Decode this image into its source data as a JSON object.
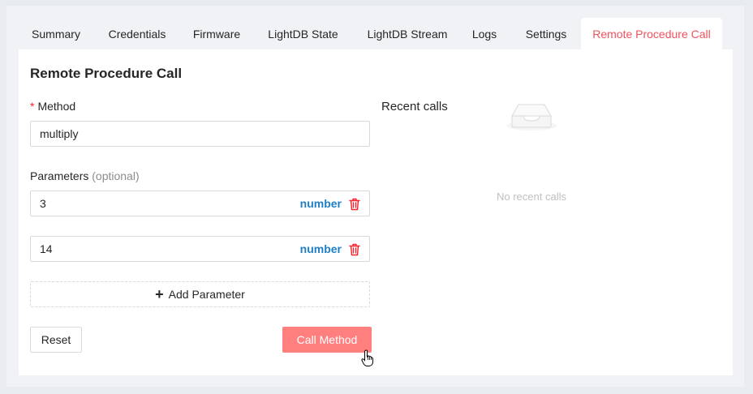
{
  "tabs": [
    {
      "label": "Summary"
    },
    {
      "label": "Credentials"
    },
    {
      "label": "Firmware"
    },
    {
      "label": "LightDB State"
    },
    {
      "label": "LightDB Stream"
    },
    {
      "label": "Logs"
    },
    {
      "label": "Settings"
    },
    {
      "label": "Remote Procedure Call"
    }
  ],
  "active_tab": "Remote Procedure Call",
  "form": {
    "title": "Remote Procedure Call",
    "method_required_mark": "*",
    "method_label": "Method",
    "method_value": "multiply",
    "parameters_label": "Parameters",
    "parameters_optional": "(optional)",
    "parameters": [
      {
        "value": "3",
        "type": "number"
      },
      {
        "value": "14",
        "type": "number"
      }
    ],
    "add_parameter_label": "Add Parameter",
    "reset_label": "Reset",
    "call_label": "Call Method"
  },
  "recent": {
    "title": "Recent calls",
    "empty_text": "No recent calls"
  },
  "icons": {
    "delete": "trash-icon",
    "add": "plus-icon",
    "empty": "inbox-icon",
    "cursor": "hand-pointer-icon"
  },
  "colors": {
    "accent": "#f0525c",
    "type_tag": "#1f7fc6",
    "call_button": "#ff7f7f",
    "delete_icon": "#f5222d"
  }
}
